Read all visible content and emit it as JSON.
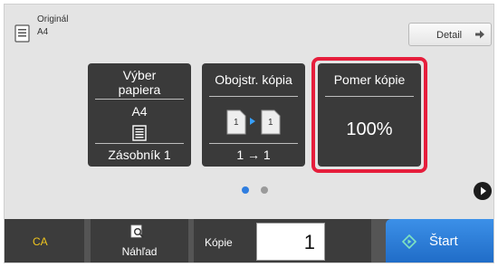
{
  "header": {
    "original_label": "Originál",
    "original_value": "A4",
    "detail_label": "Detail"
  },
  "tiles": {
    "paper": {
      "title_line1": "Výber",
      "title_line2": "papiera",
      "size": "A4",
      "tray": "Zásobník 1"
    },
    "duplex": {
      "title": "Obojstr. kópia",
      "mode": "1 → 1"
    },
    "ratio": {
      "title": "Pomer kópie",
      "value": "100%"
    }
  },
  "pager": {
    "pages": 2,
    "current": 1
  },
  "footer": {
    "ca_label": "CA",
    "preview_label": "Náhľad",
    "copies_label": "Kópie",
    "copies_value": "1",
    "start_label": "Štart"
  },
  "colors": {
    "accent_blue": "#2f7ee0",
    "highlight_red": "#e61e3c",
    "ca_yellow": "#f0c51e",
    "tile_dark": "#3a3a3a"
  },
  "icons": [
    "original-document-icon",
    "arrow-right-icon",
    "paper-tray-icon",
    "duplex-copy-icon",
    "play-icon",
    "preview-magnifier-icon",
    "start-diamond-icon"
  ]
}
